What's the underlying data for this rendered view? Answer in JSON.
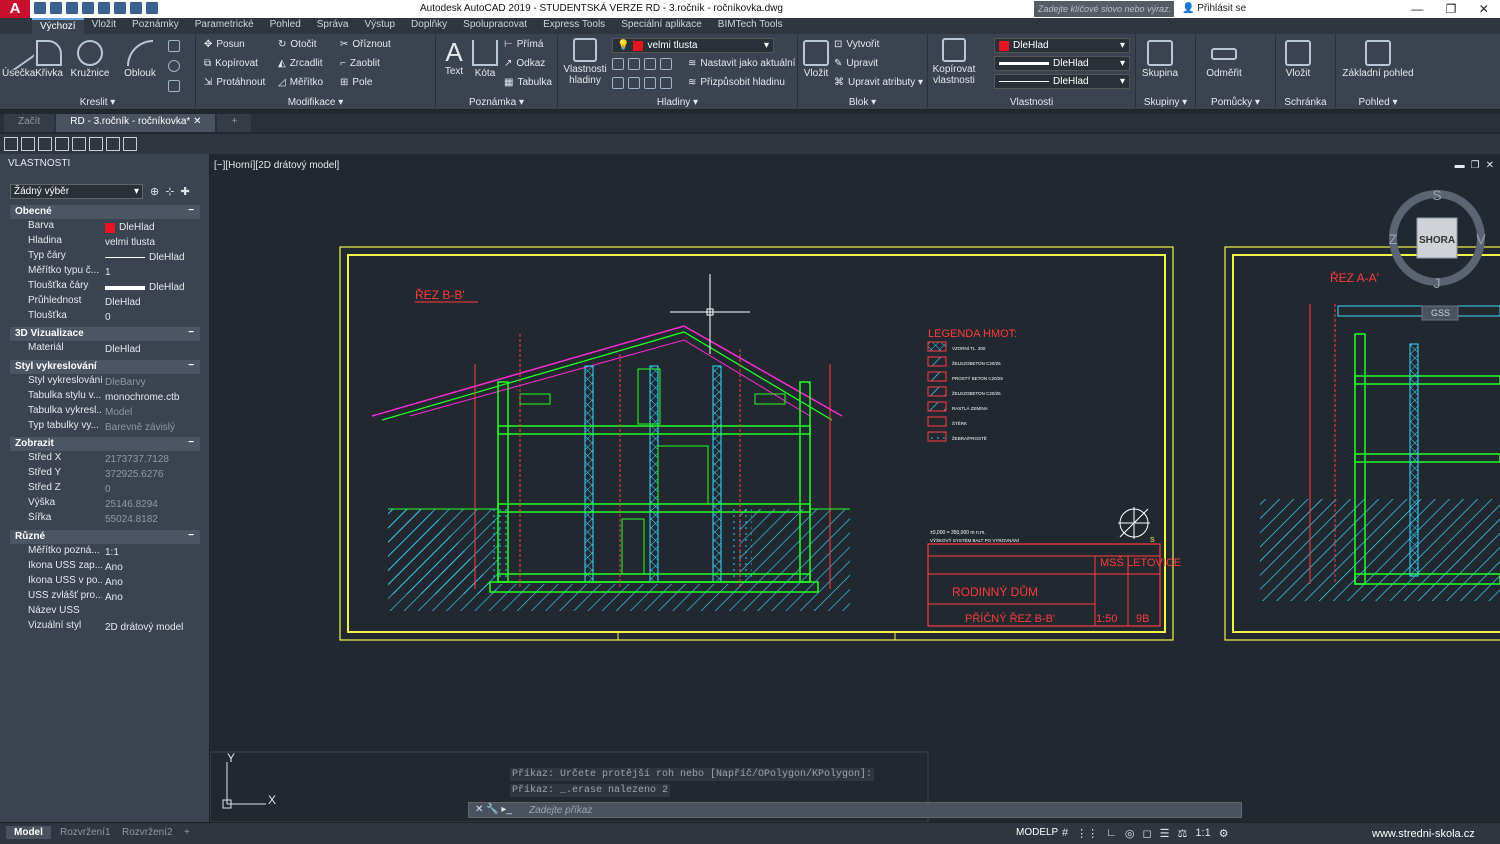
{
  "app": {
    "logo": "A",
    "title": "Autodesk AutoCAD 2019 - STUDENTSKÁ VERZE    RD - 3.ročník - ročníkovka.dwg",
    "search_placeholder": "Zadejte klíčové slovo nebo výraz.",
    "signin": "Přihlásit se",
    "win_buttons": [
      "—",
      "❐",
      "✕"
    ]
  },
  "ribbon_tabs": [
    "Výchozí",
    "Vložit",
    "Poznámky",
    "Parametrické",
    "Pohled",
    "Správa",
    "Výstup",
    "Doplňky",
    "Spolupracovat",
    "Express Tools",
    "Speciální aplikace",
    "BIMTech Tools"
  ],
  "ribbon": {
    "kreslit": {
      "label": "Kreslit ▾",
      "buttons": [
        "Úsečka",
        "Křivka",
        "Kružnice",
        "Oblouk"
      ]
    },
    "modifikace": {
      "label": "Modifikace ▾",
      "buttons": [
        "Posun",
        "Otočit",
        "Oříznout",
        "Kopírovat",
        "Zrcadlit",
        "Zaoblit",
        "Protáhnout",
        "Měřítko",
        "Pole"
      ]
    },
    "poznamka": {
      "label": "Poznámka ▾",
      "buttons": [
        "Text",
        "Kóta",
        "Přímá",
        "Odkaz",
        "Tabulka"
      ]
    },
    "hladiny": {
      "label": "Hladiny ▾",
      "big": "Vlastnosti hladiny",
      "layer": "velmi tlusta",
      "buttons": [
        "Nastavit jako aktuální",
        "Přizpůsobit hladinu"
      ]
    },
    "blok": {
      "label": "Blok ▾",
      "big": "Vložit",
      "buttons": [
        "Vytvořit",
        "Upravit",
        "Upravit atributy ▾"
      ]
    },
    "vlastnosti": {
      "label": "Vlastnosti",
      "big": "Kopírovat vlastnosti",
      "color": "DleHlad",
      "lineweight": "DleHlad",
      "linetype": "DleHlad"
    },
    "skupiny": {
      "label": "Skupiny ▾",
      "big": "Skupina"
    },
    "pomucky": {
      "label": "Pomůcky ▾",
      "big": "Odměřit"
    },
    "schranka": {
      "label": "Schránka",
      "big": "Vložit"
    },
    "pohled": {
      "label": "Pohled ▾",
      "big": "Základní pohled"
    }
  },
  "doc_tabs": [
    "Začít",
    "RD - 3.ročník - ročníkovka*",
    "+"
  ],
  "properties": {
    "header": "VLASTNOSTI",
    "selection": "Žádný výběr",
    "sections": [
      {
        "title": "Obecné",
        "rows": [
          [
            "Barva",
            "DleHlad"
          ],
          [
            "Hladina",
            "velmi tlusta"
          ],
          [
            "Typ čáry",
            "DleHlad"
          ],
          [
            "Měřítko typu č...",
            "1"
          ],
          [
            "Tloušťka čáry",
            "DleHlad"
          ],
          [
            "Průhlednost",
            "DleHlad"
          ],
          [
            "Tloušťka",
            "0"
          ]
        ]
      },
      {
        "title": "3D Vizualizace",
        "rows": [
          [
            "Materiál",
            "DleHlad"
          ]
        ]
      },
      {
        "title": "Styl vykreslování",
        "rows": [
          [
            "Styl vykreslování",
            "DleBarvy"
          ],
          [
            "Tabulka stylu v...",
            "monochrome.ctb"
          ],
          [
            "Tabulka vykresl...",
            "Model"
          ],
          [
            "Typ tabulky vy...",
            "Barevně závislý"
          ]
        ]
      },
      {
        "title": "Zobrazit",
        "rows": [
          [
            "Střed X",
            "2173737.7128"
          ],
          [
            "Střed Y",
            "372925.6276"
          ],
          [
            "Střed Z",
            "0"
          ],
          [
            "Výška",
            "25146.8294"
          ],
          [
            "Šířka",
            "55024.8182"
          ]
        ]
      },
      {
        "title": "Různé",
        "rows": [
          [
            "Měřítko pozná...",
            "1:1"
          ],
          [
            "Ikona USS zap...",
            "Ano"
          ],
          [
            "Ikona USS v po...",
            "Ano"
          ],
          [
            "USS zvlášť pro...",
            "Ano"
          ],
          [
            "Název USS",
            ""
          ],
          [
            "Vizuální styl",
            "2D drátový model"
          ]
        ]
      }
    ]
  },
  "viewport": {
    "label": "[−][Horní][2D drátový model]",
    "viewcube": {
      "face": "SHORA",
      "n": "S",
      "s": "J",
      "w": "Z",
      "e": "V",
      "wcs": "GSS"
    },
    "ucs_x": "X",
    "ucs_y": "Y"
  },
  "drawing": {
    "section_bb": "ŘEZ B-B'",
    "section_aa": "ŘEZ A-A'",
    "legend_title": "LEGENDA HMOT:",
    "legend": [
      "VZORNÍ TL. 300",
      "ŽELEZOBETON C20/25",
      "PROSTÝ BETON C20/25",
      "ŽELEZOBETON C20/25",
      "RASTLÁ ZEMINA",
      "ŠTĚRK",
      "ŽEBRA/PROSTĚ"
    ],
    "title_block": {
      "scale": "±0,000 = 350,000 m n.m.",
      "system": "VÝŠKOVÝ SYSTÉM BALT PO VYROVNÁNÍ",
      "school": "MSŠ LETOVICE",
      "project": "RODINNÝ DŮM",
      "drawing": "PŘÍČNÝ ŘEZ B-B'",
      "ratio": "1:50",
      "number": "9B"
    },
    "north": "S"
  },
  "command": {
    "history": [
      "Příkaz: Určete protější roh nebo [Napříč/OPolygon/KPolygon]:",
      "Příkaz: _.erase nalezeno 2"
    ],
    "placeholder": "Zadejte příkaz"
  },
  "status": {
    "layout_tabs": [
      "Model",
      "Rozvržení1",
      "Rozvržení2",
      "+"
    ],
    "space": "MODELP",
    "scale": "1:1",
    "watermark": "www.stredni-skola.cz"
  },
  "colors": {
    "layer_red": "#e8141f",
    "green": "#22ff22",
    "magenta": "#ff2bd6",
    "yellow": "#f4f24a",
    "cyan": "#36d8ff",
    "red": "#ff3b3b",
    "bg": "#212830"
  }
}
